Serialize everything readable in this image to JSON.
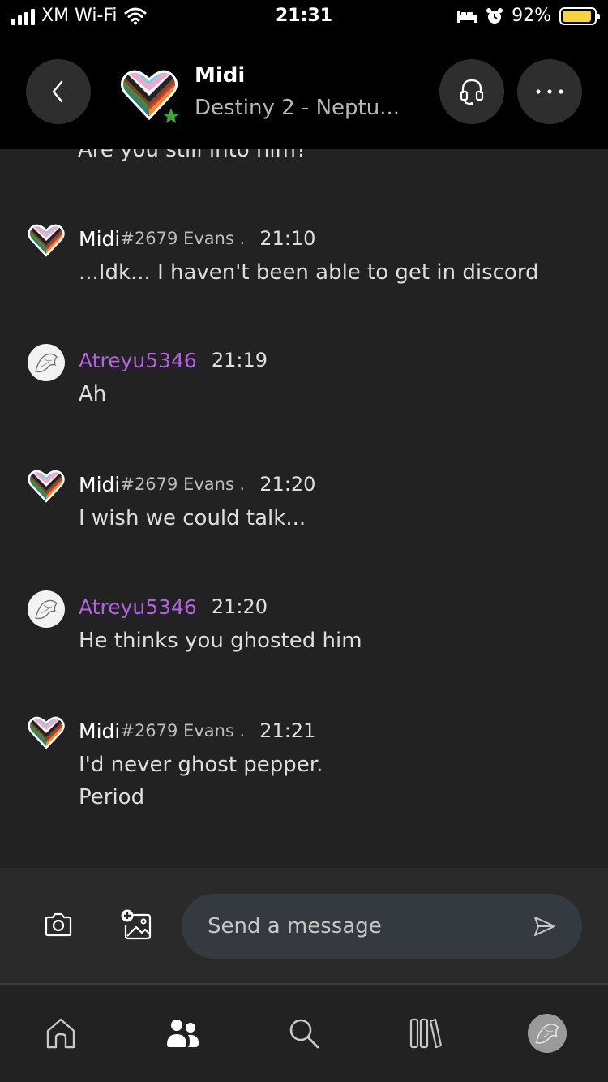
{
  "status_bar": {
    "carrier": "XM Wi-Fi",
    "time": "21:31",
    "battery": "92%",
    "battery_level": 0.92
  },
  "header": {
    "name": "Midi",
    "status": "Destiny 2 - Neptu..."
  },
  "messages": {
    "partial_above": "Are you still into him?",
    "items": [
      {
        "author": "Midi",
        "tag": "#2679 Evans .",
        "time": "21:10",
        "lines": [
          "...Idk... I haven't been able to get in discord"
        ]
      },
      {
        "author": "Atreyu5346",
        "tag": "",
        "time": "21:19",
        "lines": [
          "Ah"
        ]
      },
      {
        "author": "Midi",
        "tag": "#2679 Evans .",
        "time": "21:20",
        "lines": [
          "I wish we could talk..."
        ]
      },
      {
        "author": "Atreyu5346",
        "tag": "",
        "time": "21:20",
        "lines": [
          "He thinks you ghosted him"
        ]
      },
      {
        "author": "Midi",
        "tag": "#2679 Evans .",
        "time": "21:21",
        "lines": [
          "I'd never ghost pepper.",
          "Period"
        ]
      }
    ]
  },
  "composer": {
    "placeholder": "Send a message"
  },
  "icons": {
    "back": "chevron-left-icon",
    "headset": "headset-icon",
    "more": "more-icon",
    "camera": "camera-icon",
    "add_image": "add-image-icon",
    "send": "send-icon",
    "home": "home-icon",
    "social": "people-icon",
    "search": "search-icon",
    "library": "library-icon"
  },
  "colors": {
    "accent_purple": "#b163e0",
    "presence_green": "#3fa535",
    "battery_yellow": "#f5d442"
  }
}
